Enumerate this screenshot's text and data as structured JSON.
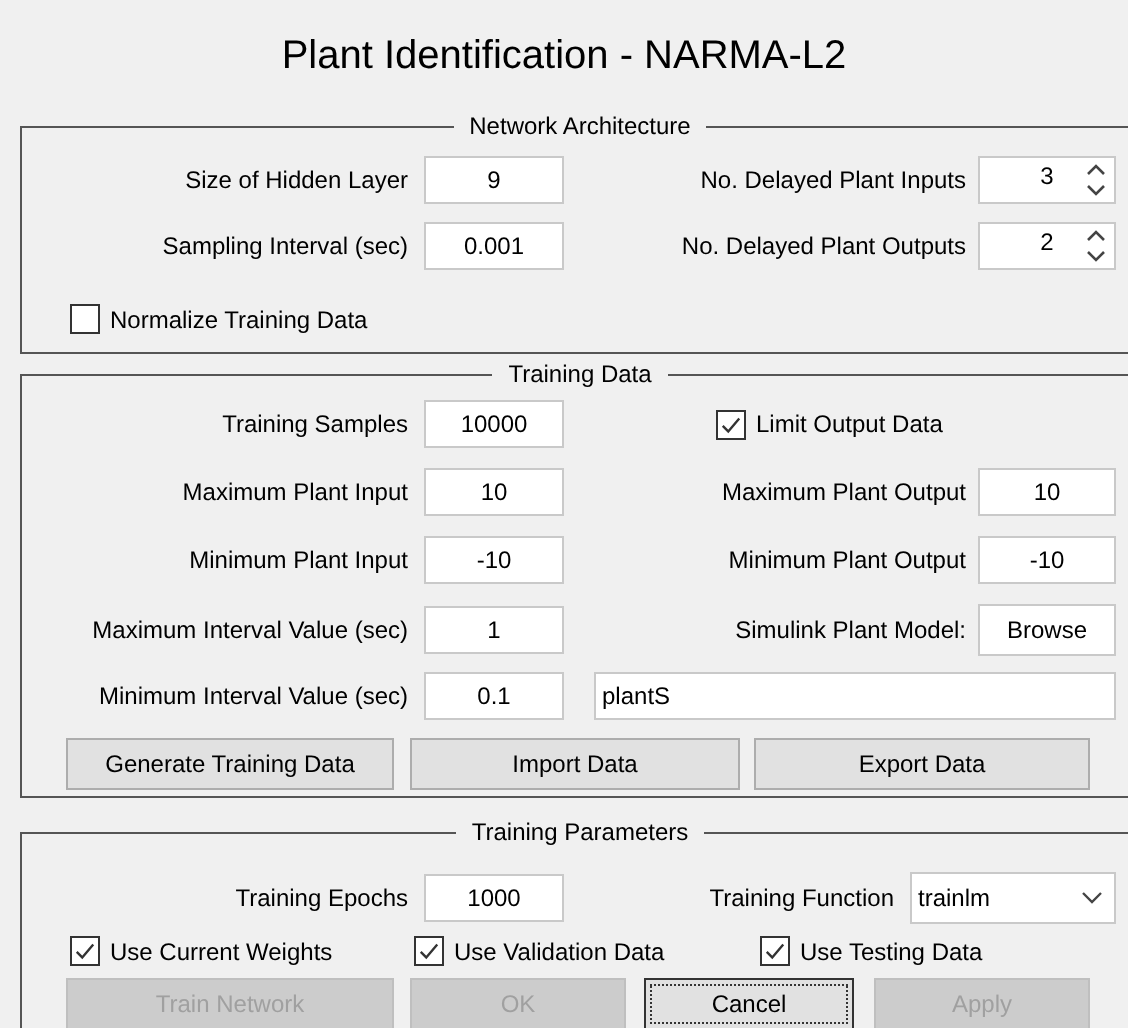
{
  "title": "Plant Identification - NARMA-L2",
  "network_architecture": {
    "title": "Network Architecture",
    "hidden_layer_size": {
      "label": "Size of Hidden Layer",
      "value": "9"
    },
    "delayed_inputs": {
      "label": "No. Delayed Plant Inputs",
      "value": "3"
    },
    "sampling_interval": {
      "label": "Sampling Interval (sec)",
      "value": "0.001"
    },
    "delayed_outputs": {
      "label": "No. Delayed Plant Outputs",
      "value": "2"
    },
    "normalize": {
      "label": "Normalize Training Data",
      "checked": false
    }
  },
  "training_data": {
    "title": "Training Data",
    "training_samples": {
      "label": "Training Samples",
      "value": "10000"
    },
    "limit_output": {
      "label": "Limit Output Data",
      "checked": true
    },
    "max_input": {
      "label": "Maximum Plant Input",
      "value": "10"
    },
    "max_output": {
      "label": "Maximum Plant Output",
      "value": "10"
    },
    "min_input": {
      "label": "Minimum Plant Input",
      "value": "-10"
    },
    "min_output": {
      "label": "Minimum Plant Output",
      "value": "-10"
    },
    "max_interval": {
      "label": "Maximum Interval Value (sec)",
      "value": "1"
    },
    "simulink_model": {
      "label": "Simulink Plant Model:",
      "button": "Browse"
    },
    "min_interval": {
      "label": "Minimum Interval Value (sec)",
      "value": "0.1"
    },
    "model_name": {
      "value": "plantS"
    },
    "buttons": [
      {
        "label": "Generate Training Data",
        "disabled": false,
        "focused": false
      },
      {
        "label": "Import Data",
        "disabled": false,
        "focused": false
      },
      {
        "label": "Export Data",
        "disabled": false,
        "focused": false
      }
    ]
  },
  "training_parameters": {
    "title": "Training Parameters",
    "epochs": {
      "label": "Training Epochs",
      "value": "1000"
    },
    "training_function": {
      "label": "Training Function",
      "value": "trainlm"
    },
    "options": [
      {
        "label": "Use Current Weights",
        "checked": true
      },
      {
        "label": "Use Validation Data",
        "checked": true
      },
      {
        "label": "Use Testing Data",
        "checked": true
      }
    ],
    "buttons": [
      {
        "label": "Train Network",
        "disabled": true,
        "focused": false
      },
      {
        "label": "OK",
        "disabled": true,
        "focused": false
      },
      {
        "label": "Cancel",
        "disabled": false,
        "focused": true
      },
      {
        "label": "Apply",
        "disabled": true,
        "focused": false
      }
    ]
  }
}
